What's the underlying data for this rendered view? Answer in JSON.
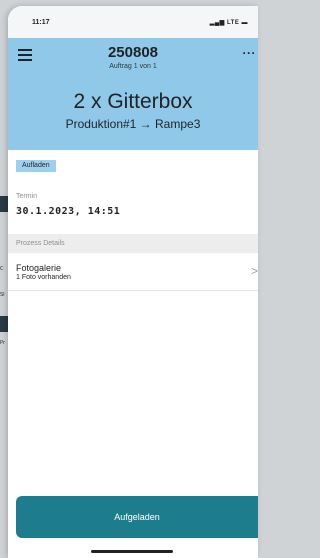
{
  "background": {
    "fragment_1": "C",
    "fragment_2": "SI",
    "fragment_3": "Pr"
  },
  "statusbar": {
    "time": "11:17",
    "icons": "LTE"
  },
  "header": {
    "order_number": "250808",
    "order_subtitle": "Auftrag 1 von 1",
    "title": "2 x Gitterbox",
    "route": "Produktion#1 → Rampe3",
    "more_icon": "···"
  },
  "status_badge": "Aufladen",
  "termin": {
    "label": "Termin",
    "value": "30.1.2023, 14:51"
  },
  "process": {
    "section_label": "Prozess Details",
    "rows": [
      {
        "title": "Fotogalerie",
        "subtitle": "1 Foto vorhanden"
      }
    ]
  },
  "action_button": "Aufgeladen",
  "colors": {
    "header": "#8fc8e8",
    "badge": "#9dd0ee",
    "primary": "#1d7d8c"
  },
  "icons": [
    "hamburger-menu-icon",
    "more-icon",
    "chevron-right-icon",
    "signal-icon",
    "battery-icon"
  ]
}
